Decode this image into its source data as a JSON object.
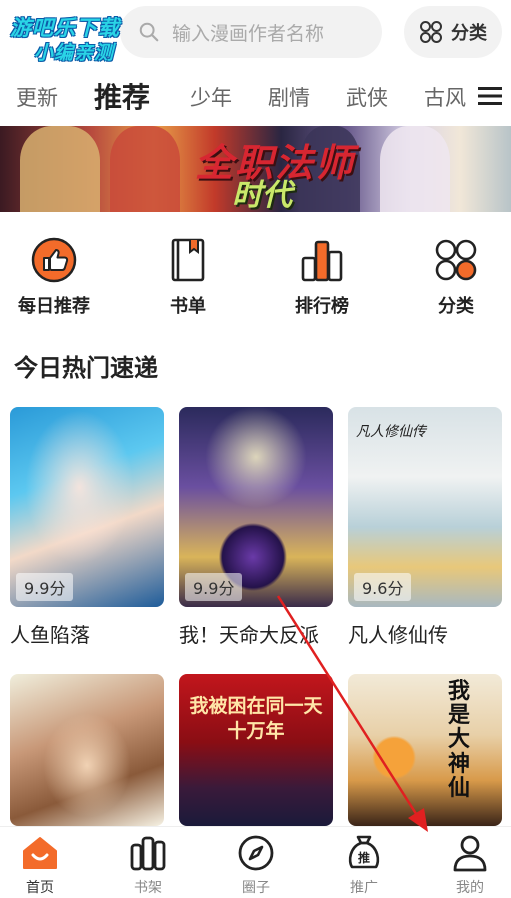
{
  "watermark": {
    "line1": "游吧乐下载",
    "line2": "小编亲测"
  },
  "search": {
    "placeholder": "输入漫画作者名称",
    "icon": "search-icon"
  },
  "category_button": {
    "label": "分类",
    "icon": "grid-icon"
  },
  "tabs": [
    {
      "label": "更新"
    },
    {
      "label": "推荐",
      "active": true
    },
    {
      "label": "少年"
    },
    {
      "label": "剧情"
    },
    {
      "label": "武侠"
    },
    {
      "label": "古风"
    }
  ],
  "banner": {
    "title": "全职法师",
    "subtitle": "时代"
  },
  "quick_actions": [
    {
      "label": "每日推荐",
      "icon": "thumbs-up-icon",
      "color": "#f36b2a"
    },
    {
      "label": "书单",
      "icon": "book-icon"
    },
    {
      "label": "排行榜",
      "icon": "ranking-icon"
    },
    {
      "label": "分类",
      "icon": "grid-icon"
    }
  ],
  "section": {
    "title": "今日热门速递"
  },
  "comics": [
    {
      "title": "人鱼陷落",
      "score": "9.9分"
    },
    {
      "title": "我！天命大反派",
      "score": "9.9分"
    },
    {
      "title": "凡人修仙传",
      "score": "9.6分",
      "cover_text": "凡人修仙传"
    },
    {
      "title": "",
      "score": "",
      "cover_text": ""
    },
    {
      "title": "",
      "score": "",
      "cover_text": "我被困在同一天十万年"
    },
    {
      "title": "",
      "score": "",
      "cover_text": "我是大神仙"
    }
  ],
  "bottom_nav": [
    {
      "label": "首页",
      "icon": "home-icon",
      "active": true,
      "color": "#f36b2a"
    },
    {
      "label": "书架",
      "icon": "bookshelf-icon"
    },
    {
      "label": "圈子",
      "icon": "compass-icon"
    },
    {
      "label": "推广",
      "icon": "promote-bag-icon",
      "badge": "推"
    },
    {
      "label": "我的",
      "icon": "profile-icon"
    }
  ],
  "colors": {
    "accent": "#f36b2a",
    "annotation_arrow": "#e02020"
  }
}
